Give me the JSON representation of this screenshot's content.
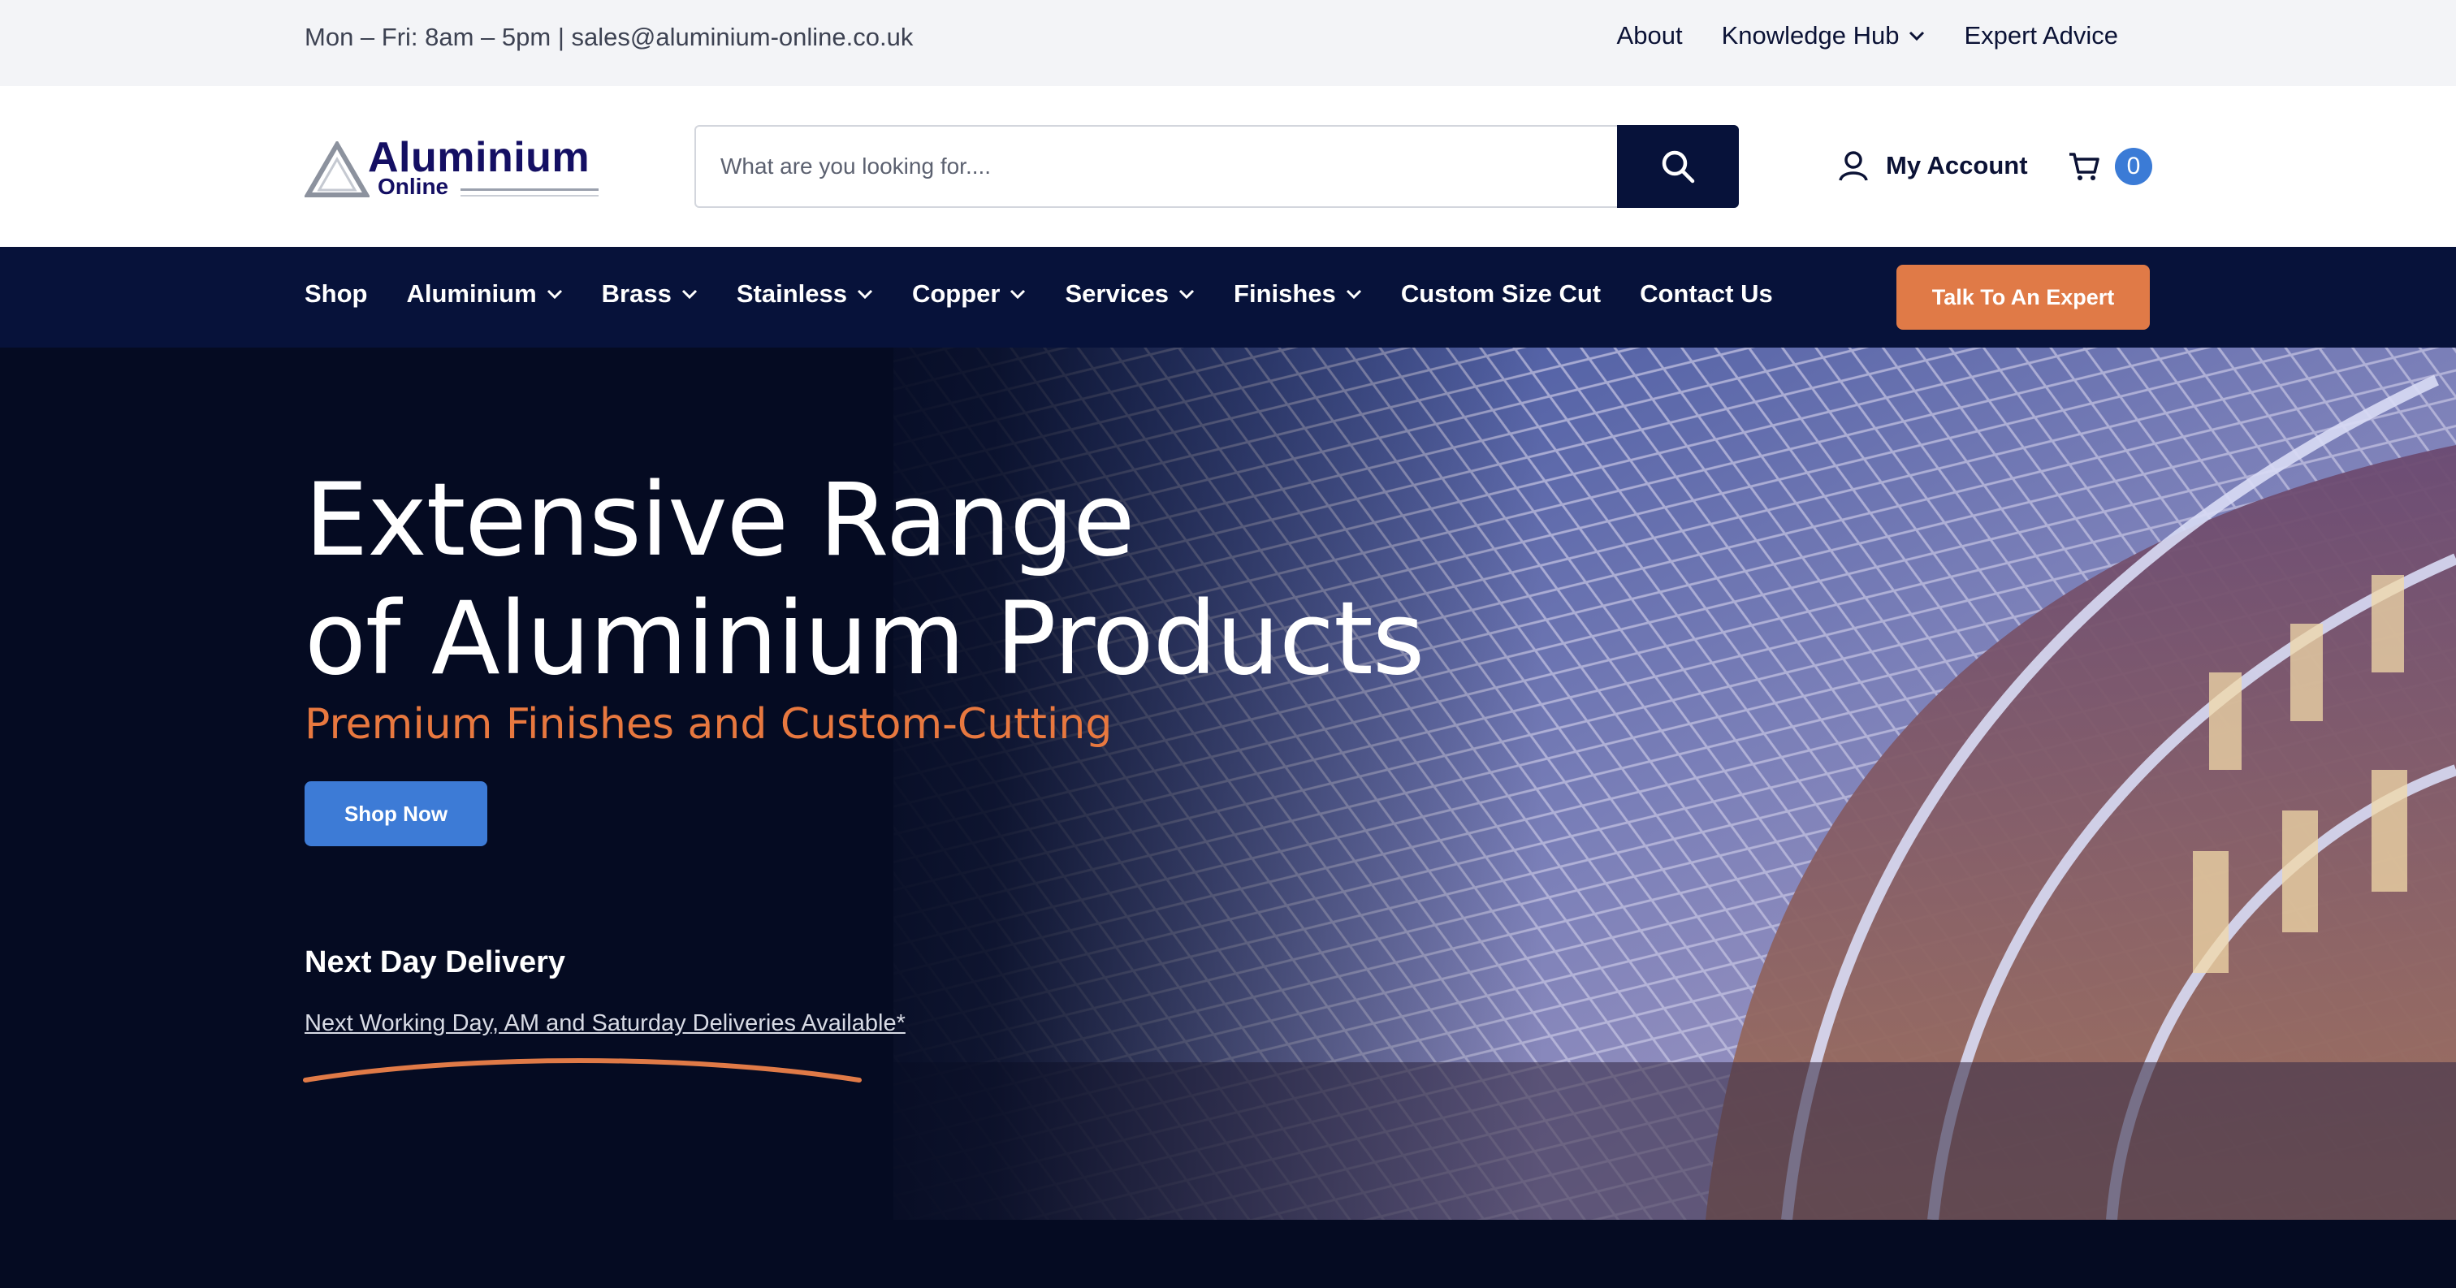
{
  "topbar": {
    "contact": "Mon – Fri: 8am – 5pm | sales@aluminium-online.co.uk",
    "links": [
      "About",
      "Knowledge Hub",
      "Expert Advice"
    ]
  },
  "header": {
    "logo_main": "Aluminium",
    "logo_sub": "Online",
    "search_placeholder": "What are you looking for....",
    "account_label": "My Account",
    "cart_count": "0"
  },
  "nav": {
    "items": [
      "Shop",
      "Aluminium",
      "Brass",
      "Stainless",
      "Copper",
      "Services",
      "Finishes",
      "Custom Size Cut",
      "Contact Us"
    ],
    "cta": "Talk To An Expert"
  },
  "hero": {
    "title_line1": "Extensive Range",
    "title_line2": "of Aluminium Products",
    "tagline": "Premium Finishes and Custom-Cutting",
    "shop_button": "Shop Now",
    "delivery_title": "Next Day Delivery",
    "delivery_link": "Next Working Day, AM and Saturday Deliveries Available*"
  },
  "colors": {
    "navy": "#07123a",
    "accent_orange": "#e07a47",
    "accent_blue": "#3d7bd6"
  }
}
